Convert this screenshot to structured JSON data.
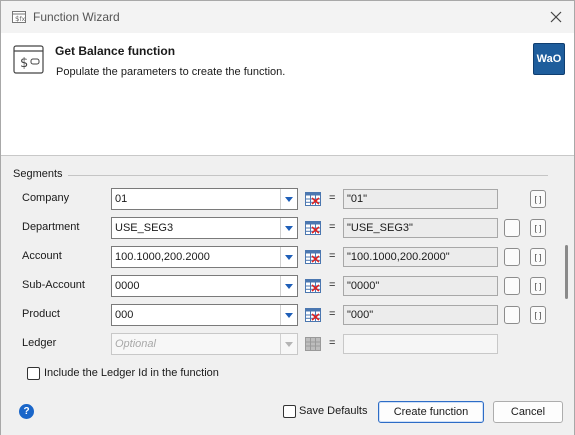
{
  "window": {
    "title": "Function Wizard"
  },
  "header": {
    "title": "Get Balance function",
    "subtitle": "Populate the parameters to create the function.",
    "logo_text": "WaO",
    "logo_color": "#1e5d9c"
  },
  "segments": {
    "label": "Segments",
    "rows": [
      {
        "label": "Company",
        "value": "01",
        "result": "\"01\""
      },
      {
        "label": "Department",
        "value": "USE_SEG3",
        "result": "\"USE_SEG3\""
      },
      {
        "label": "Account",
        "value": "100.1000,200.2000",
        "result": "\"100.1000,200.2000\""
      },
      {
        "label": "Sub-Account",
        "value": "0000",
        "result": "\"0000\""
      },
      {
        "label": "Product",
        "value": "000",
        "result": "\"000\""
      },
      {
        "label": "Ledger",
        "placeholder": "Optional",
        "result": ""
      }
    ],
    "equals": "=",
    "include_ledger_label": "Include the Ledger Id in the function",
    "include_ledger_checked": false
  },
  "footer": {
    "help_icon": "question-circle-icon",
    "help_glyph": "?",
    "save_defaults_label": "Save Defaults",
    "save_defaults_checked": false,
    "create_label": "Create function",
    "cancel_label": "Cancel"
  },
  "colors": {
    "accent": "#2d6cc6",
    "help": "#1a66c9"
  }
}
